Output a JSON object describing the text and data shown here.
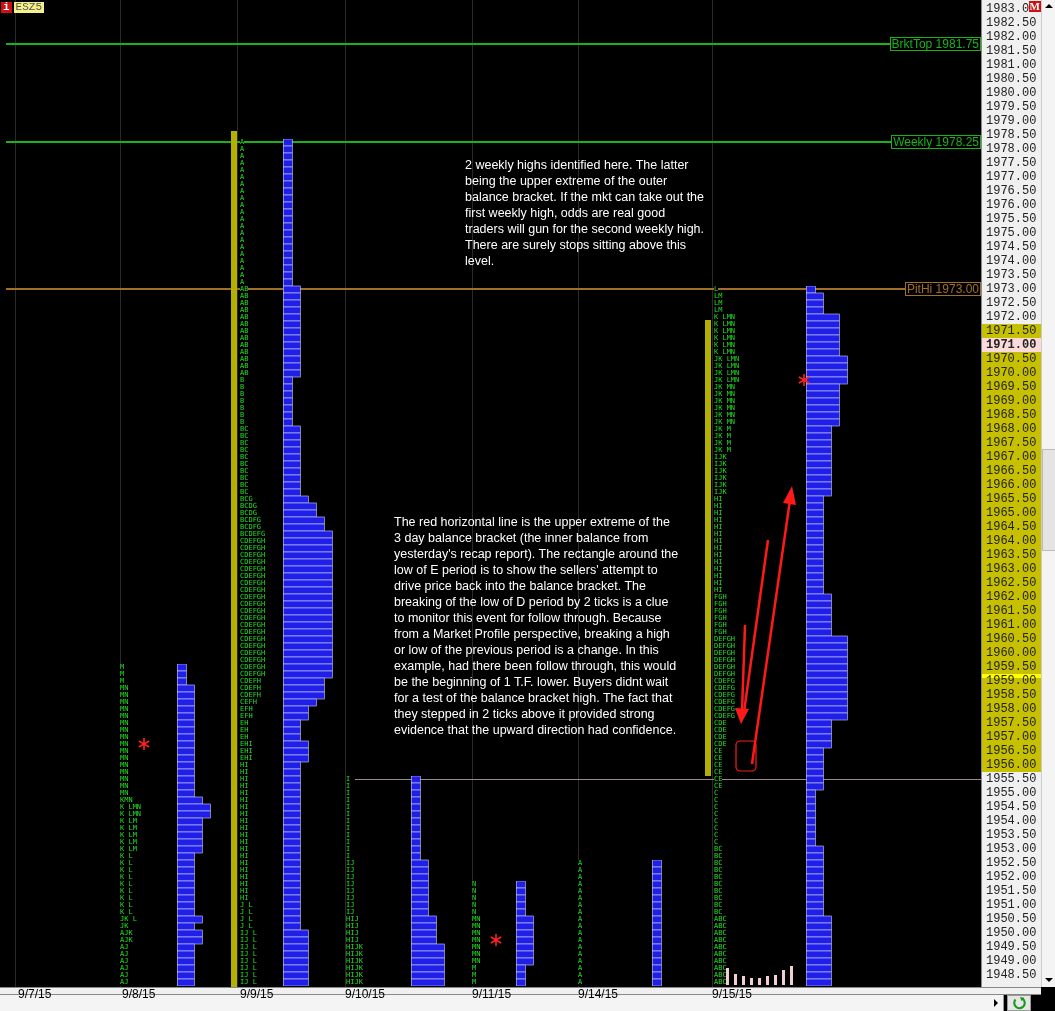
{
  "instrument": {
    "badge": "i",
    "symbol": "ESZ5"
  },
  "axis_badge": "M",
  "levels": [
    {
      "label": "BrktTop 1981.75",
      "color": "#19b319"
    },
    {
      "label": "Weekly 1978.25",
      "color": "#19b319"
    },
    {
      "label": "PitHi 1973.00",
      "color": "#a0702a"
    }
  ],
  "notes": [
    {
      "text": "2 weekly highs identified here. The latter\nbeing the upper extreme of the outer\nbalance bracket. If the mkt can take out the\nfirst weekly high, odds are real good\ntraders will gun for the second weekly high.\nThere are surely stops sitting above this\nlevel."
    },
    {
      "text": "The red horizontal line is the upper extreme of the\n3 day balance bracket (the inner balance from\nyesterday's recap report). The rectangle around the\nlow of E period is to show the sellers' attempt to\ndrive price back into the balance bracket. The\nbreaking of the low of D period by 2 ticks is a clue\nto monitor this event for follow through. Because\nfrom a Market Profile perspective, breaking a high\nor low of the previous period is a change. In this\nexample, had there been follow through, this would\nbe the beginning of 1 T.F. lower. Buyers didnt wait\nfor a test of the balance bracket high. The fact that\nthey stepped in 2 ticks above it provided strong\nevidence that the upward direction had confidence."
    }
  ],
  "days": [
    {
      "date": "9/7/15"
    },
    {
      "date": "9/8/15",
      "session": {
        "tpo": [
          "M",
          "M",
          "M",
          "MN",
          "MN",
          "MN",
          "MN",
          "MN",
          "MN",
          "MN",
          "MN",
          "MN",
          "MN",
          "MN",
          "MN",
          "MN",
          "MN",
          "MN",
          "MN",
          "KMN",
          "K LMN",
          "K LMN",
          "K LM",
          "K LM",
          "K LM",
          "K LM",
          "K LM",
          "K L",
          "K L",
          "K L",
          "K L",
          "K L",
          "K L",
          "K L",
          "K L",
          "K L",
          "JK L",
          "JK",
          "AJK",
          "AJK",
          "AJ",
          "AJ",
          "AJ",
          "AJ",
          "AJ",
          "AJ"
        ]
      }
    },
    {
      "date": "9/9/15",
      "session": {
        "tpo": [
          "A",
          "A",
          "A",
          "A",
          "A",
          "A",
          "A",
          "A",
          "A",
          "A",
          "A",
          "A",
          "A",
          "A",
          "A",
          "A",
          "A",
          "A",
          "A",
          "A",
          "A",
          "AB",
          "AB",
          "AB",
          "AB",
          "AB",
          "AB",
          "AB",
          "AB",
          "AB",
          "AB",
          "AB",
          "AB",
          "AB",
          "B",
          "B",
          "B",
          "B",
          "B",
          "B",
          "B",
          "BC",
          "BC",
          "BC",
          "BC",
          "BC",
          "BC",
          "BC",
          "BC",
          "BC",
          "BC",
          "BCG",
          "BCDG",
          "BCDG",
          "BCDFG",
          "BCDFG",
          "BCDEFG",
          "CDEFGH",
          "CDEFGH",
          "CDEFGH",
          "CDEFGH",
          "CDEFGH",
          "CDEFGH",
          "CDEFGH",
          "CDEFGH",
          "CDEFGH",
          "CDEFGH",
          "CDEFGH",
          "CDEFGH",
          "CDEFGH",
          "CDEFGH",
          "CDEFGH",
          "CDEFGH",
          "CDEFGH",
          "CDEFGH",
          "CDEFGH",
          "CDEFGH",
          "CDEFH",
          "CDEFH",
          "CDEFH",
          "CEFH",
          "EFH",
          "EFH",
          "EH",
          "EH",
          "EH",
          "EHI",
          "EHI",
          "EHI",
          "HI",
          "HI",
          "HI",
          "HI",
          "HI",
          "HI",
          "HI",
          "HI",
          "HI",
          "HI",
          "HI",
          "HI",
          "HI",
          "HI",
          "HI",
          "HI",
          "HI",
          "HI",
          "HI",
          "HI",
          "J L",
          "J L",
          "J L",
          "J L",
          "IJ L",
          "IJ L",
          "IJ L",
          "IJ L",
          "IJ L",
          "IJ L",
          "IJ L",
          "IJ L"
        ]
      }
    },
    {
      "date": "9/10/15",
      "session": {
        "tpo": [
          "I",
          "I",
          "I",
          "I",
          "I",
          "I",
          "I",
          "I",
          "I",
          "I",
          "I",
          "I",
          "IJ",
          "IJ",
          "IJ",
          "IJ",
          "IJ",
          "IJ",
          "IJ",
          "IJ",
          "HIJ",
          "HIJ",
          "HIJ",
          "HIJ",
          "HIJK",
          "HIJK",
          "HIJK",
          "HIJK",
          "HIJK",
          "HIJK"
        ]
      }
    },
    {
      "date": "9/11/15",
      "session": {
        "tpo": [
          "N",
          "N",
          "N",
          "N",
          "N",
          "MN",
          "MN",
          "MN",
          "MN",
          "MN",
          "MN",
          "MN",
          "M",
          "M",
          "M"
        ]
      }
    },
    {
      "date": "9/14/15",
      "session": {
        "tpo": [
          "A",
          "A",
          "A",
          "A",
          "A",
          "A",
          "A",
          "A",
          "A",
          "A",
          "A",
          "A",
          "A",
          "A",
          "A",
          "A",
          "A",
          "A"
        ]
      }
    },
    {
      "date": "9/15/15",
      "session": {
        "tpo": [
          "L",
          "LM",
          "LM",
          "LM",
          "K LMN",
          "K LMN",
          "K LMN",
          "K LMN",
          "K LMN",
          "K LMN",
          "JK LMN",
          "JK LMN",
          "JK LMN",
          "JK LMN",
          "JK MN",
          "JK MN",
          "JK MN",
          "JK MN",
          "JK MN",
          "JK MN",
          "JK M",
          "JK M",
          "JK M",
          "JK M",
          "IJK",
          "IJK",
          "IJK",
          "IJK",
          "IJK",
          "IJK",
          "HI",
          "HI",
          "HI",
          "HI",
          "HI",
          "HI",
          "HI",
          "HI",
          "HI",
          "HI",
          "HI",
          "HI",
          "HI",
          "HI",
          "FGH",
          "FGH",
          "FGH",
          "FGH",
          "FGH",
          "FGH",
          "DEFGH",
          "DEFGH",
          "DEFGH",
          "DEFGH",
          "DEFGH",
          "DEFGH",
          "CDEFG",
          "CDEFG",
          "CDEFG",
          "CDEFG",
          "CDEFG",
          "CDEFG",
          "CDE",
          "CDE",
          "CDE",
          "CDE",
          "CE",
          "CE",
          "CE",
          "CE",
          "CE",
          "CE",
          "C",
          "C",
          "C",
          "C",
          "C",
          "C",
          "C",
          "C",
          "BC",
          "BC",
          "BC",
          "BC",
          "BC",
          "BC",
          "BC",
          "BC",
          "BC",
          "BC",
          "ABC",
          "ABC",
          "ABC",
          "ABC",
          "ABC",
          "ABC",
          "ABC",
          "ABC",
          "ABC",
          "ABC"
        ]
      }
    }
  ],
  "price_axis": [
    {
      "text": "1983.0",
      "kind": "plain"
    },
    {
      "text": "1982.50",
      "kind": "plain"
    },
    {
      "text": "1982.00",
      "kind": "plain"
    },
    {
      "text": "1981.50",
      "kind": "plain"
    },
    {
      "text": "1981.00",
      "kind": "plain"
    },
    {
      "text": "1980.50",
      "kind": "plain"
    },
    {
      "text": "1980.00",
      "kind": "plain"
    },
    {
      "text": "1979.50",
      "kind": "plain"
    },
    {
      "text": "1979.00",
      "kind": "plain"
    },
    {
      "text": "1978.50",
      "kind": "plain"
    },
    {
      "text": "1978.00",
      "kind": "plain"
    },
    {
      "text": "1977.50",
      "kind": "plain"
    },
    {
      "text": "1977.00",
      "kind": "plain"
    },
    {
      "text": "1976.50",
      "kind": "plain"
    },
    {
      "text": "1976.00",
      "kind": "plain"
    },
    {
      "text": "1975.50",
      "kind": "plain"
    },
    {
      "text": "1975.00",
      "kind": "plain"
    },
    {
      "text": "1974.50",
      "kind": "plain"
    },
    {
      "text": "1974.00",
      "kind": "plain"
    },
    {
      "text": "1973.50",
      "kind": "plain"
    },
    {
      "text": "1973.00",
      "kind": "plain"
    },
    {
      "text": "1972.50",
      "kind": "plain"
    },
    {
      "text": "1972.00",
      "kind": "plain"
    },
    {
      "text": "1971.50",
      "kind": "band"
    },
    {
      "text": "1971.00",
      "kind": "current"
    },
    {
      "text": "1970.50",
      "kind": "band"
    },
    {
      "text": "1970.00",
      "kind": "band"
    },
    {
      "text": "1969.50",
      "kind": "band"
    },
    {
      "text": "1969.00",
      "kind": "band"
    },
    {
      "text": "1968.50",
      "kind": "band"
    },
    {
      "text": "1968.00",
      "kind": "band"
    },
    {
      "text": "1967.50",
      "kind": "band"
    },
    {
      "text": "1967.00",
      "kind": "band"
    },
    {
      "text": "1966.50",
      "kind": "band"
    },
    {
      "text": "1966.00",
      "kind": "band"
    },
    {
      "text": "1965.50",
      "kind": "band"
    },
    {
      "text": "1965.00",
      "kind": "band"
    },
    {
      "text": "1964.50",
      "kind": "band"
    },
    {
      "text": "1964.00",
      "kind": "band"
    },
    {
      "text": "1963.50",
      "kind": "band"
    },
    {
      "text": "1963.00",
      "kind": "band"
    },
    {
      "text": "1962.50",
      "kind": "band"
    },
    {
      "text": "1962.00",
      "kind": "band"
    },
    {
      "text": "1961.50",
      "kind": "band"
    },
    {
      "text": "1961.00",
      "kind": "band"
    },
    {
      "text": "1960.50",
      "kind": "band"
    },
    {
      "text": "1960.00",
      "kind": "band"
    },
    {
      "text": "1959.50",
      "kind": "band"
    },
    {
      "text": "1959.00",
      "kind": "poc"
    },
    {
      "text": "1958.50",
      "kind": "band"
    },
    {
      "text": "1958.00",
      "kind": "band"
    },
    {
      "text": "1957.50",
      "kind": "band"
    },
    {
      "text": "1957.00",
      "kind": "band"
    },
    {
      "text": "1956.50",
      "kind": "band"
    },
    {
      "text": "1956.00",
      "kind": "band"
    },
    {
      "text": "1955.50",
      "kind": "plain"
    },
    {
      "text": "1955.00",
      "kind": "plain"
    },
    {
      "text": "1954.50",
      "kind": "plain"
    },
    {
      "text": "1954.00",
      "kind": "plain"
    },
    {
      "text": "1953.50",
      "kind": "plain"
    },
    {
      "text": "1953.00",
      "kind": "plain"
    },
    {
      "text": "1952.50",
      "kind": "plain"
    },
    {
      "text": "1952.00",
      "kind": "plain"
    },
    {
      "text": "1951.50",
      "kind": "plain"
    },
    {
      "text": "1951.00",
      "kind": "plain"
    },
    {
      "text": "1950.50",
      "kind": "plain"
    },
    {
      "text": "1950.00",
      "kind": "plain"
    },
    {
      "text": "1949.50",
      "kind": "plain"
    },
    {
      "text": "1949.00",
      "kind": "plain"
    },
    {
      "text": "1948.50",
      "kind": "plain"
    }
  ]
}
